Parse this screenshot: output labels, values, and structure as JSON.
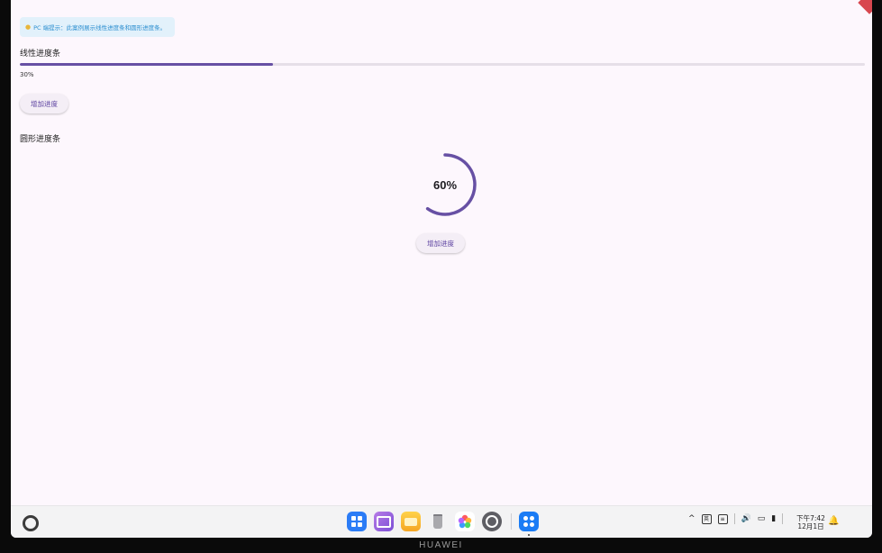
{
  "hint": {
    "icon": "lightbulb-icon",
    "text": "PC 端提示：此案例展示线性进度条和圆形进度条。"
  },
  "linear": {
    "title": "线性进度条",
    "progress": 0.3,
    "percent_text": "30%",
    "button_label": "增加进度"
  },
  "circular": {
    "title": "圆形进度条",
    "progress": 0.6,
    "percent_text": "60%",
    "button_label": "增加进度"
  },
  "colors": {
    "accent": "#6750a4",
    "track": "#e6dfe8",
    "background": "#fdf7fd",
    "hint_bg": "#e2f1fb",
    "hint_text": "#2d8fd0"
  },
  "taskbar": {
    "apps": [
      {
        "name": "app-center-icon",
        "color": "#2b7cf6"
      },
      {
        "name": "gallery-icon",
        "color": "#9b59d6"
      },
      {
        "name": "files-icon",
        "color": "#f5b62c"
      },
      {
        "name": "trash-icon",
        "color": "#9e9e9e"
      },
      {
        "name": "photos-icon",
        "color": "#ffffff"
      },
      {
        "name": "settings-icon",
        "color": "#6d6d73"
      }
    ],
    "pinned_app": {
      "name": "app-launcher-icon",
      "color": "#1b7cf5"
    },
    "tray": {
      "input_method": "英"
    },
    "clock": {
      "time": "下午7:42",
      "date": "12月1日"
    }
  },
  "device_brand": "HUAWEI"
}
